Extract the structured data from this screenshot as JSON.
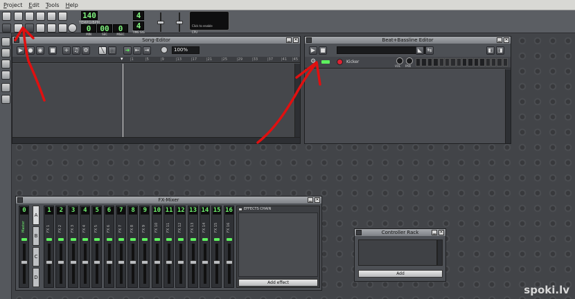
{
  "menu": [
    "Project",
    "Edit",
    "Tools",
    "Help"
  ],
  "toolbar": {
    "tempo_value": "140",
    "tempo_label": "TEMPO/BPM",
    "time_min": "0",
    "time_sec": "00",
    "time_msec": "0",
    "time_min_label": "MIN",
    "time_sec_label": "SEC",
    "time_msec_label": "MSEC",
    "timesig_top": "4",
    "timesig_bottom": "4",
    "timesig_label": "TIME SIG",
    "cpu_label": "CPU",
    "cpu_hint": "Click to enable"
  },
  "song_editor": {
    "title": "Song-Editor",
    "zoom": "100%",
    "ruler": [
      "|1",
      "|5",
      "|9",
      "|13",
      "|17",
      "|21",
      "|25",
      "|29",
      "|33",
      "|37",
      "|41",
      "|45"
    ]
  },
  "bb_editor": {
    "title": "Beat+Bassline Editor",
    "track_name": "Kicker",
    "vol_label": "VOL",
    "pan_label": "PAN"
  },
  "fx_mixer": {
    "title": "FX-Mixer",
    "master_label": "Master",
    "channels": [
      "0",
      "1",
      "2",
      "3",
      "4",
      "5",
      "6",
      "7",
      "8",
      "9",
      "10",
      "11",
      "12",
      "13",
      "14",
      "15",
      "16"
    ],
    "channel_names": [
      "FX 1",
      "FX 2",
      "FX 3",
      "FX 4",
      "FX 5",
      "FX 6",
      "FX 7",
      "FX 8",
      "FX 9",
      "FX 10",
      "FX 11",
      "FX 12",
      "FX 13",
      "FX 14",
      "FX 15",
      "FX 16"
    ],
    "banks": [
      "A",
      "B",
      "C",
      "D"
    ],
    "effects_chain_label": "EFFECTS CHAIN",
    "add_effect": "Add effect"
  },
  "controller_rack": {
    "title": "Controller Rack",
    "add": "Add"
  },
  "watermark": "spoki.lv",
  "colors": {
    "lcd_green": "#7ef27e",
    "arrow_red": "#e01010",
    "title_gray": "#a6a9ad"
  }
}
